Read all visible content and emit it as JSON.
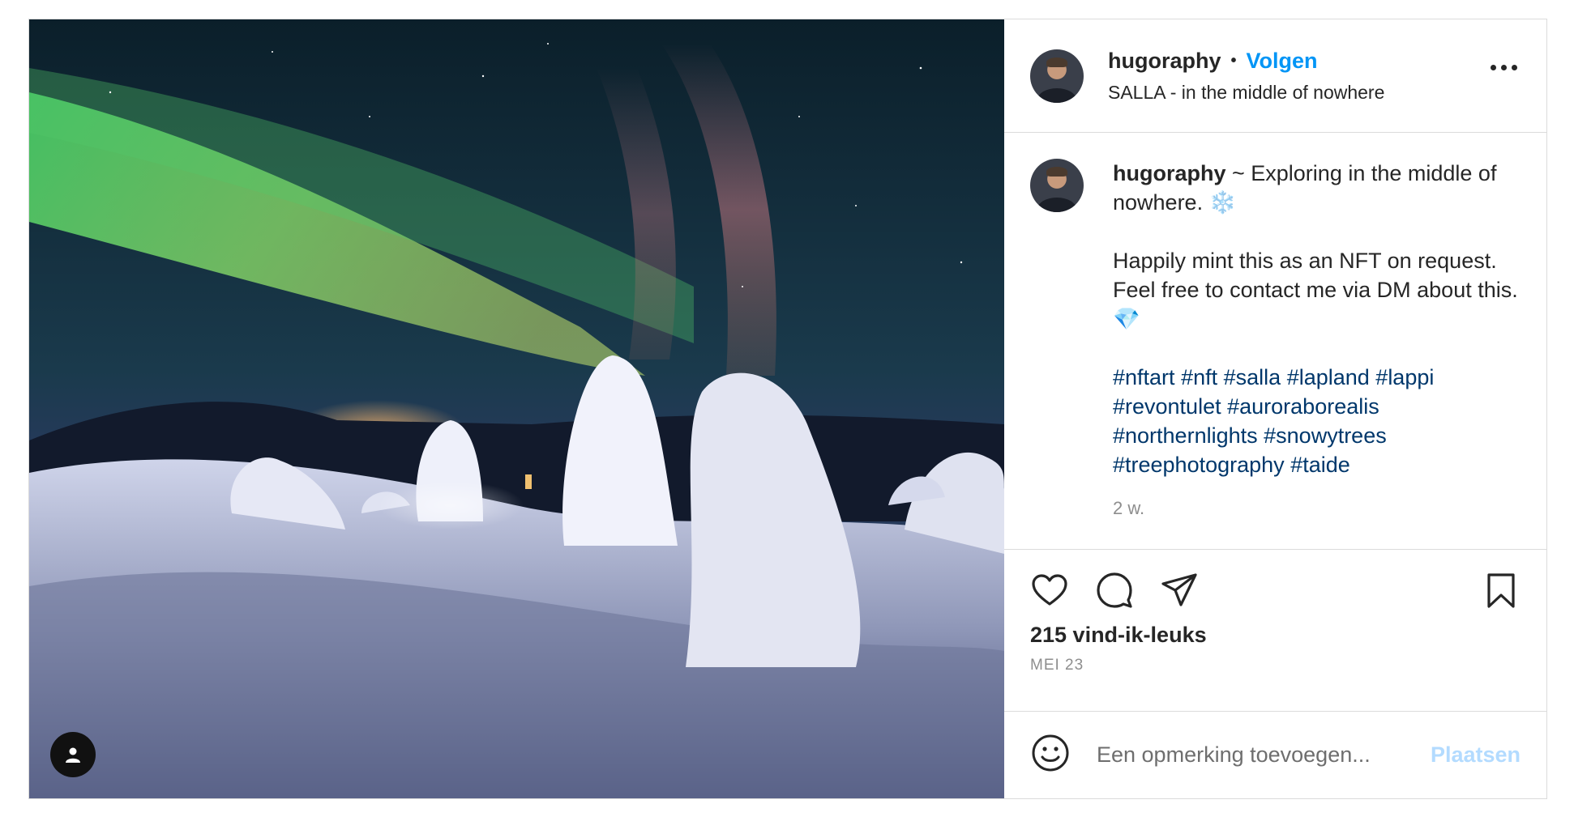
{
  "post": {
    "username": "hugoraphy",
    "separator": "•",
    "follow_label": "Volgen",
    "location": "SALLA - in the middle of nowhere",
    "caption": {
      "username": "hugoraphy",
      "line1": " ~ Exploring in the middle of nowhere. ❄️",
      "paragraph2": "Happily mint this as an NFT on request. Feel free to contact me via DM about this. 💎",
      "hashtags": [
        "#nftart",
        "#nft",
        "#salla",
        "#lapland",
        "#lappi",
        "#revontulet",
        "#auroraborealis",
        "#northernlights",
        "#snowytrees",
        "#treephotography",
        "#taide"
      ],
      "age": "2 w."
    },
    "likes": "215 vind-ik-leuks",
    "date": "MEI 23",
    "comment_placeholder": "Een opmerking toevoegen...",
    "post_button": "Plaatsen"
  },
  "icons": {
    "media": "person-tag-icon",
    "more": "more-options-icon",
    "like": "heart-icon",
    "comment": "comment-bubble-icon",
    "share": "paper-plane-icon",
    "save": "bookmark-icon",
    "emoji": "smiley-icon"
  },
  "colors": {
    "accent": "#0095f6",
    "hashtag": "#00376b",
    "muted": "#8e8e8e",
    "border": "#dbdbdb",
    "post_disabled": "#b3dbff"
  }
}
